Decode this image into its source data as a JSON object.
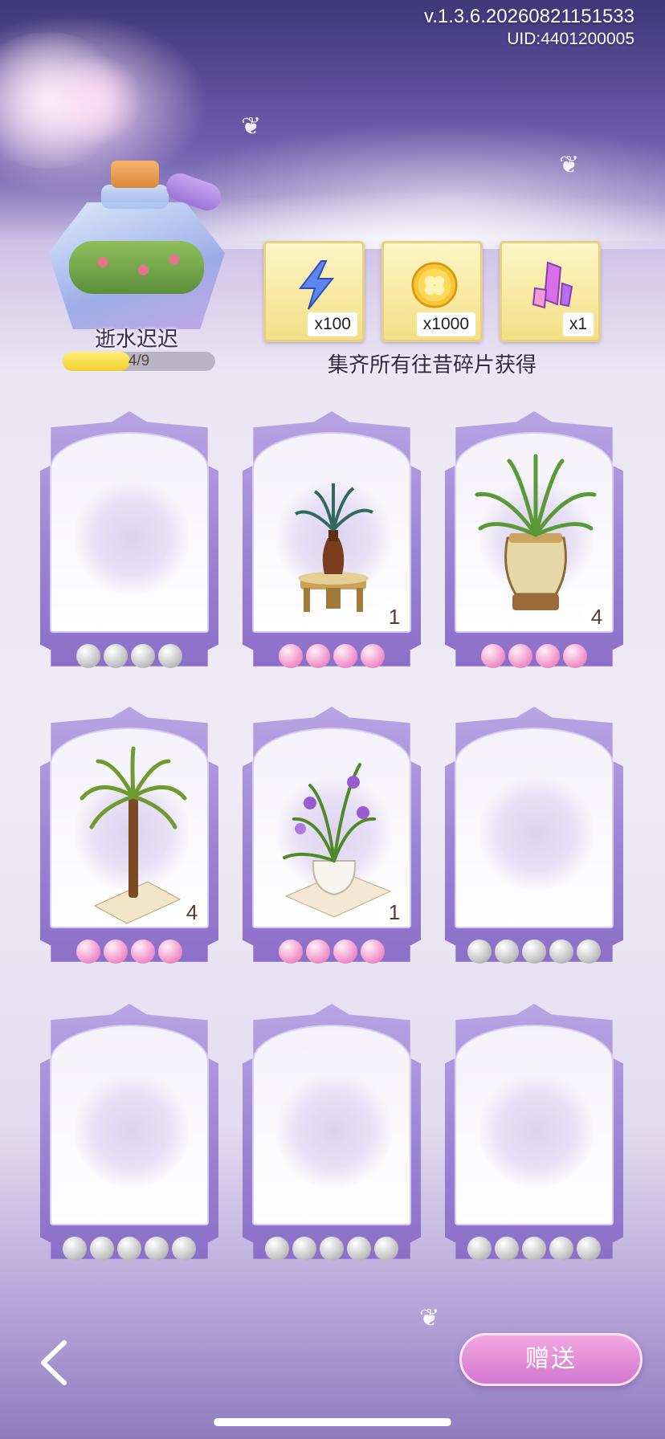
{
  "header": {
    "version": "v.1.3.6.20260821151533",
    "uid": "UID:4401200005"
  },
  "collection": {
    "name": "逝水迟迟",
    "progress_text": "4/9",
    "progress_fraction": 0.444
  },
  "rewards": {
    "items": [
      {
        "icon": "energy-lightning-icon",
        "quantity": "x100"
      },
      {
        "icon": "gold-coin-clover-icon",
        "quantity": "x1000"
      },
      {
        "icon": "pink-crystal-icon",
        "quantity": "x1"
      }
    ],
    "caption": "集齐所有往昔碎片获得"
  },
  "cards": [
    {
      "plant": "empty",
      "count": "",
      "dots": "grey",
      "dot_count": 4
    },
    {
      "plant": "palm-on-moroccan-table",
      "count": "1",
      "dots": "pink",
      "dot_count": 4
    },
    {
      "plant": "spider-plant-vase",
      "count": "4",
      "dots": "pink",
      "dot_count": 4
    },
    {
      "plant": "tall-palm-tree",
      "count": "4",
      "dots": "pink",
      "dot_count": 4
    },
    {
      "plant": "purple-orchid-pot",
      "count": "1",
      "dots": "pink",
      "dot_count": 4
    },
    {
      "plant": "empty",
      "count": "",
      "dots": "grey",
      "dot_count": 5
    },
    {
      "plant": "empty",
      "count": "",
      "dots": "grey",
      "dot_count": 5
    },
    {
      "plant": "empty",
      "count": "",
      "dots": "grey",
      "dot_count": 5
    },
    {
      "plant": "empty",
      "count": "",
      "dots": "grey",
      "dot_count": 5
    }
  ],
  "footer": {
    "gift_label": "赠送"
  },
  "colors": {
    "card_frame": "#9a82d4",
    "gift_button": "#e18fda",
    "progress_fill": "#f1cf2a"
  }
}
